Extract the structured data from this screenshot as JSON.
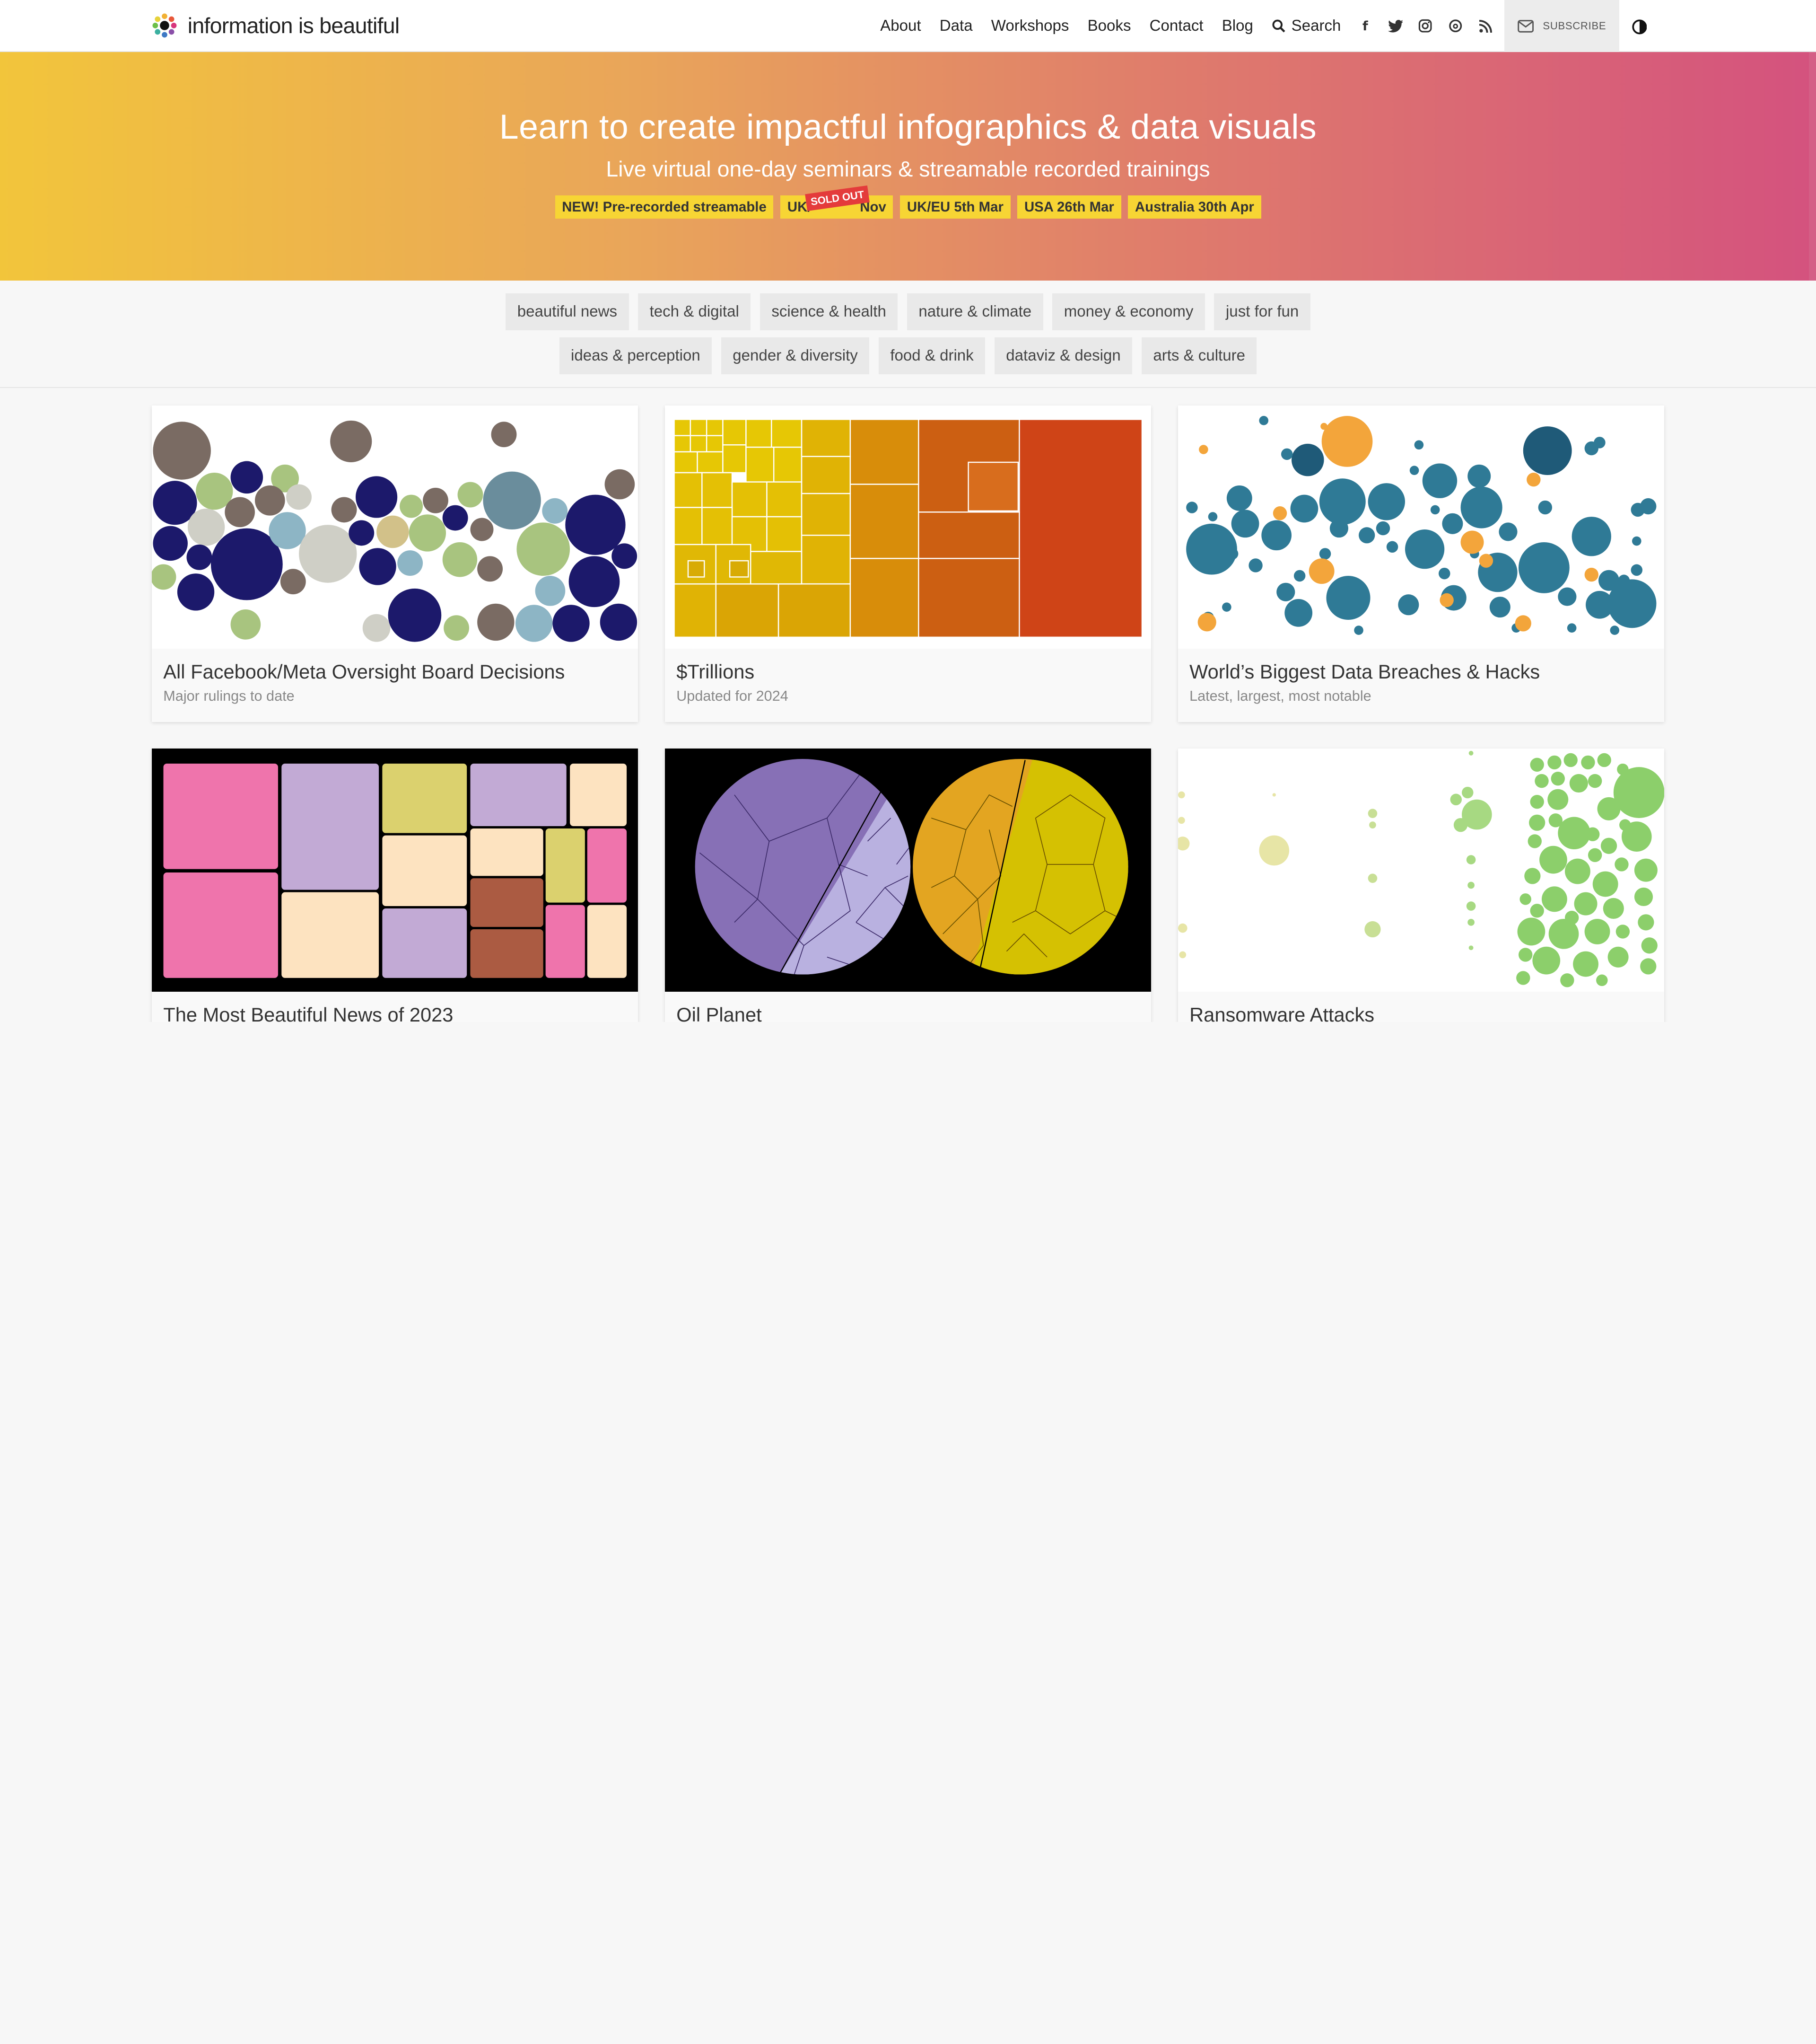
{
  "header": {
    "logo_text": "information is beautiful",
    "nav": [
      "About",
      "Data",
      "Workshops",
      "Books",
      "Contact",
      "Blog"
    ],
    "search_label": "Search",
    "social_icons": [
      "facebook-icon",
      "twitter-icon",
      "instagram-icon",
      "threads-icon",
      "rss-icon"
    ],
    "subscribe_label": "SUBSCRIBE"
  },
  "hero": {
    "title": "Learn to create impactful infographics & data visuals",
    "subtitle": "Live virtual one-day seminars & streamable recorded trainings",
    "badges": [
      "NEW! Pre-recorded streamable",
      "UK/",
      "Nov",
      "UK/EU 5th Mar",
      "USA 26th Mar",
      "Australia 30th Apr"
    ],
    "sold_out": "SOLD OUT"
  },
  "tags": {
    "row1": [
      "beautiful news",
      "tech & digital",
      "science & health",
      "nature & climate",
      "money & economy",
      "just for fun"
    ],
    "row2": [
      "ideas & perception",
      "gender & diversity",
      "food & drink",
      "dataviz & design",
      "arts & culture"
    ]
  },
  "cards": [
    {
      "title": "All Facebook/Meta Oversight Board Decisions",
      "subtitle": "Major rulings to date"
    },
    {
      "title": "$Trillions",
      "subtitle": "Updated for 2024"
    },
    {
      "title": "World’s Biggest Data Breaches & Hacks",
      "subtitle": "Latest, largest, most notable"
    },
    {
      "title": "The Most Beautiful News of 2023",
      "subtitle": ""
    },
    {
      "title": "Oil Planet",
      "subtitle": ""
    },
    {
      "title": "Ransomware Attacks",
      "subtitle": ""
    }
  ],
  "colors": {
    "hero_start": "#f2c53b",
    "hero_end": "#d4527e",
    "badge": "#f7d534",
    "sold_out": "#e43b3b"
  }
}
